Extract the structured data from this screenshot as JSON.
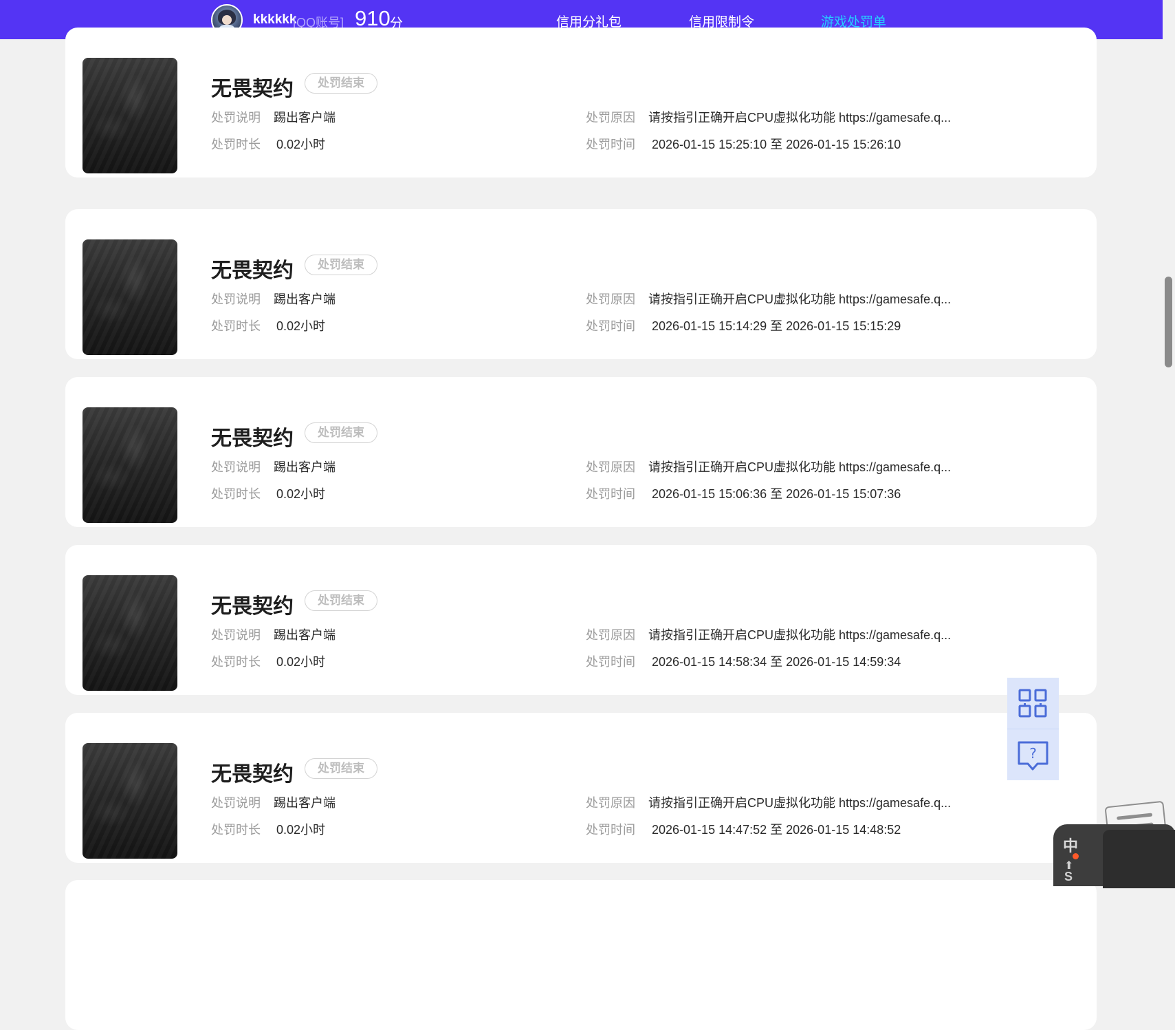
{
  "header": {
    "username": "kkkkkk",
    "account_type": "[QQ账号]",
    "score": "910",
    "score_unit": "分",
    "tabs": [
      {
        "label": "信用分礼包"
      },
      {
        "label": "信用限制令"
      },
      {
        "label": "游戏处罚单",
        "active": true
      }
    ],
    "colors": {
      "bar": "#5434f4",
      "active_tab": "#25d0ff"
    }
  },
  "labels": {
    "desc": "处罚说明",
    "duration": "处罚时长",
    "reason": "处罚原因",
    "time": "处罚时间"
  },
  "records": [
    {
      "game": "无畏契约",
      "status": "处罚结束",
      "desc": "踢出客户端",
      "duration": "0.02小时",
      "reason": "请按指引正确开启CPU虚拟化功能 https://gamesafe.q...",
      "time": "2026-01-15 15:25:10 至 2026-01-15 15:26:10"
    },
    {
      "game": "无畏契约",
      "status": "处罚结束",
      "desc": "踢出客户端",
      "duration": "0.02小时",
      "reason": "请按指引正确开启CPU虚拟化功能 https://gamesafe.q...",
      "time": "2026-01-15 15:14:29 至 2026-01-15 15:15:29"
    },
    {
      "game": "无畏契约",
      "status": "处罚结束",
      "desc": "踢出客户端",
      "duration": "0.02小时",
      "reason": "请按指引正确开启CPU虚拟化功能 https://gamesafe.q...",
      "time": "2026-01-15 15:06:36 至 2026-01-15 15:07:36"
    },
    {
      "game": "无畏契约",
      "status": "处罚结束",
      "desc": "踢出客户端",
      "duration": "0.02小时",
      "reason": "请按指引正确开启CPU虚拟化功能 https://gamesafe.q...",
      "time": "2026-01-15 14:58:34 至 2026-01-15 14:59:34"
    },
    {
      "game": "无畏契约",
      "status": "处罚结束",
      "desc": "踢出客户端",
      "duration": "0.02小时",
      "reason": "请按指引正确开启CPU虚拟化功能 https://gamesafe.q...",
      "time": "2026-01-15 14:47:52 至 2026-01-15 14:48:52"
    }
  ],
  "floating": {
    "qr_icon": "qrcode-icon",
    "help_icon": "help-chat-icon"
  },
  "ime": {
    "mode": "中"
  }
}
